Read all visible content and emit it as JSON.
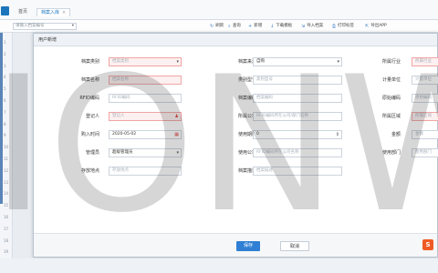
{
  "tabs": [
    {
      "label": "首页"
    },
    {
      "label": "档案入库",
      "close": "×"
    }
  ],
  "toolbar": {
    "combo_placeholder": "请输入档案编号",
    "combo_arrow": "▾",
    "tools": [
      {
        "icon": "refresh-icon",
        "glyph": "↻",
        "label": "刷新"
      },
      {
        "icon": "search-icon",
        "glyph": "⌕",
        "label": "查询"
      },
      {
        "icon": "add-icon",
        "glyph": "+",
        "label": "新增"
      },
      {
        "icon": "download-icon",
        "glyph": "↓",
        "label": "下载模板"
      },
      {
        "icon": "import-icon",
        "glyph": "⇲",
        "label": "导入档案"
      },
      {
        "icon": "print-icon",
        "glyph": "⎙",
        "label": "打印标签"
      },
      {
        "icon": "export-icon",
        "glyph": "⇱",
        "label": "导出APP"
      }
    ]
  },
  "left_rows": [
    "1",
    "2",
    "3",
    "4",
    "5",
    "6",
    "7",
    "8",
    "9",
    "10",
    "11",
    "12",
    "13",
    "14",
    "15",
    "16",
    "17",
    "18",
    "19"
  ],
  "modal": {
    "title": "用户新增",
    "fields": [
      {
        "label": "档案类别",
        "value": "档案类别",
        "required": true,
        "suffix": "▾",
        "kind": "select"
      },
      {
        "label": "档案名称",
        "value": "档案名称",
        "required": true,
        "suffix": "",
        "kind": "text"
      },
      {
        "label": "RFID编码",
        "value": "RFID编码",
        "required": false,
        "suffix": "",
        "kind": "text"
      },
      {
        "label": "登记人",
        "value": "登记人",
        "required": true,
        "suffix": "♟",
        "kind": "user"
      },
      {
        "label": "购入时间",
        "value": "2020-05-02",
        "required": false,
        "suffix": "▦",
        "kind": "date"
      },
      {
        "label": "管理员",
        "value": "超级管理员",
        "required": false,
        "suffix": "▾",
        "kind": "select"
      },
      {
        "label": "存放地点",
        "value": "存放地点",
        "required": false,
        "suffix": "",
        "kind": "text"
      },
      {
        "label": "档案来源",
        "value": "自购",
        "required": false,
        "suffix": "▾",
        "kind": "select"
      },
      {
        "label": "类别型号",
        "value": "类别型号",
        "required": false,
        "suffix": "",
        "kind": "text"
      },
      {
        "label": "档案编码",
        "value": "档案编码",
        "required": false,
        "suffix": "",
        "kind": "text"
      },
      {
        "label": "所属公司",
        "value": "RFID编码所在公司/部门名称",
        "required": false,
        "suffix": "",
        "kind": "text"
      },
      {
        "label": "使用期限",
        "value": "0",
        "required": false,
        "suffix": "⇕",
        "kind": "number"
      },
      {
        "label": "使用公司",
        "value": "RFID编码所在公司名称",
        "required": false,
        "suffix": "",
        "kind": "text"
      },
      {
        "label": "档案描述",
        "value": "档案描述",
        "required": false,
        "suffix": "",
        "kind": "text"
      },
      {
        "label": "所属行业",
        "value": "所属行业",
        "required": true,
        "suffix": "",
        "kind": "text"
      },
      {
        "label": "计量单位",
        "value": "计量单位",
        "required": false,
        "suffix": "",
        "kind": "text"
      },
      {
        "label": "原始编码",
        "value": "原始编码",
        "required": false,
        "suffix": "",
        "kind": "text"
      },
      {
        "label": "所属区域",
        "value": "所属区域",
        "required": true,
        "suffix": "",
        "kind": "text"
      },
      {
        "label": "金额",
        "value": "金额",
        "required": false,
        "suffix": "",
        "kind": "text"
      },
      {
        "label": "使用部门",
        "value": "使用部门",
        "required": false,
        "suffix": "",
        "kind": "text"
      }
    ],
    "save_label": "保存",
    "cancel_label": "取消",
    "ime_label": "S"
  },
  "watermark": "IONWI",
  "colors": {
    "accent": "#2f7fd4",
    "required_bg": "#fdf0f0",
    "required_border": "#f1a5a5",
    "ime": "#ef5b25"
  }
}
